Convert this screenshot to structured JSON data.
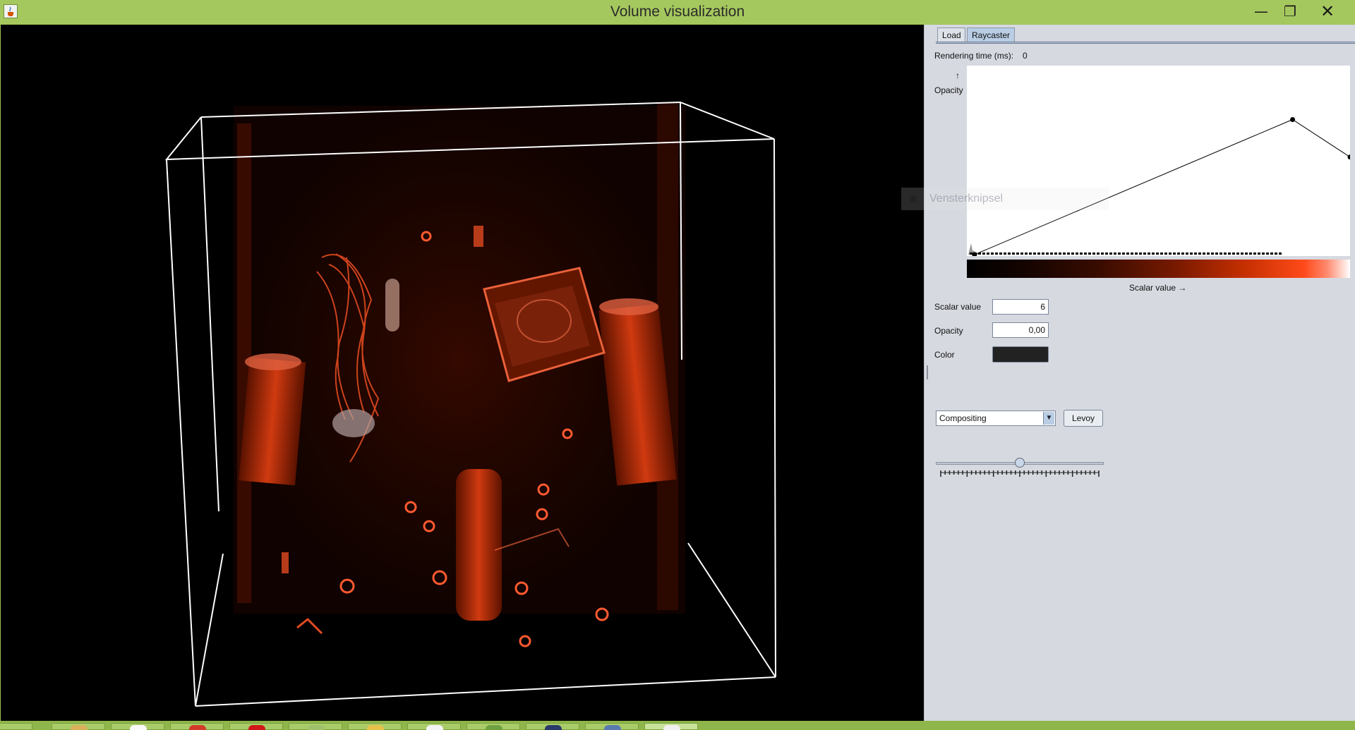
{
  "window": {
    "title": "Volume visualization",
    "controls": {
      "minimize": "—",
      "maximize": "❐",
      "close": "✕"
    }
  },
  "tabs": [
    {
      "label": "Load",
      "selected": false
    },
    {
      "label": "Raycaster",
      "selected": true
    }
  ],
  "panel": {
    "rendering_time_label": "Rendering time (ms):",
    "rendering_time_value": "0",
    "transfer_function": {
      "y_arrow": "↑",
      "y_label": "Opacity",
      "x_label": "Scalar value →",
      "control_points": [
        {
          "scalar_fraction": 0.02,
          "opacity": 0.0
        },
        {
          "scalar_fraction": 0.85,
          "opacity": 0.72
        },
        {
          "scalar_fraction": 1.0,
          "opacity": 0.52
        }
      ]
    },
    "scalar_value_label": "Scalar value",
    "scalar_value": "6",
    "opacity_label": "Opacity",
    "opacity_value": "0,00",
    "color_label": "Color",
    "color_value": "#222222",
    "mode_select": "Compositing",
    "mode_arrow": "▼",
    "levoy_button": "Levoy",
    "slider_fraction": 0.5
  },
  "overlay": {
    "text": "Vensterknipsel"
  },
  "colors": {
    "title_bar": "#a5c85e",
    "panel_bg": "#d6d9e0",
    "volume_tint": "#c42f00"
  }
}
